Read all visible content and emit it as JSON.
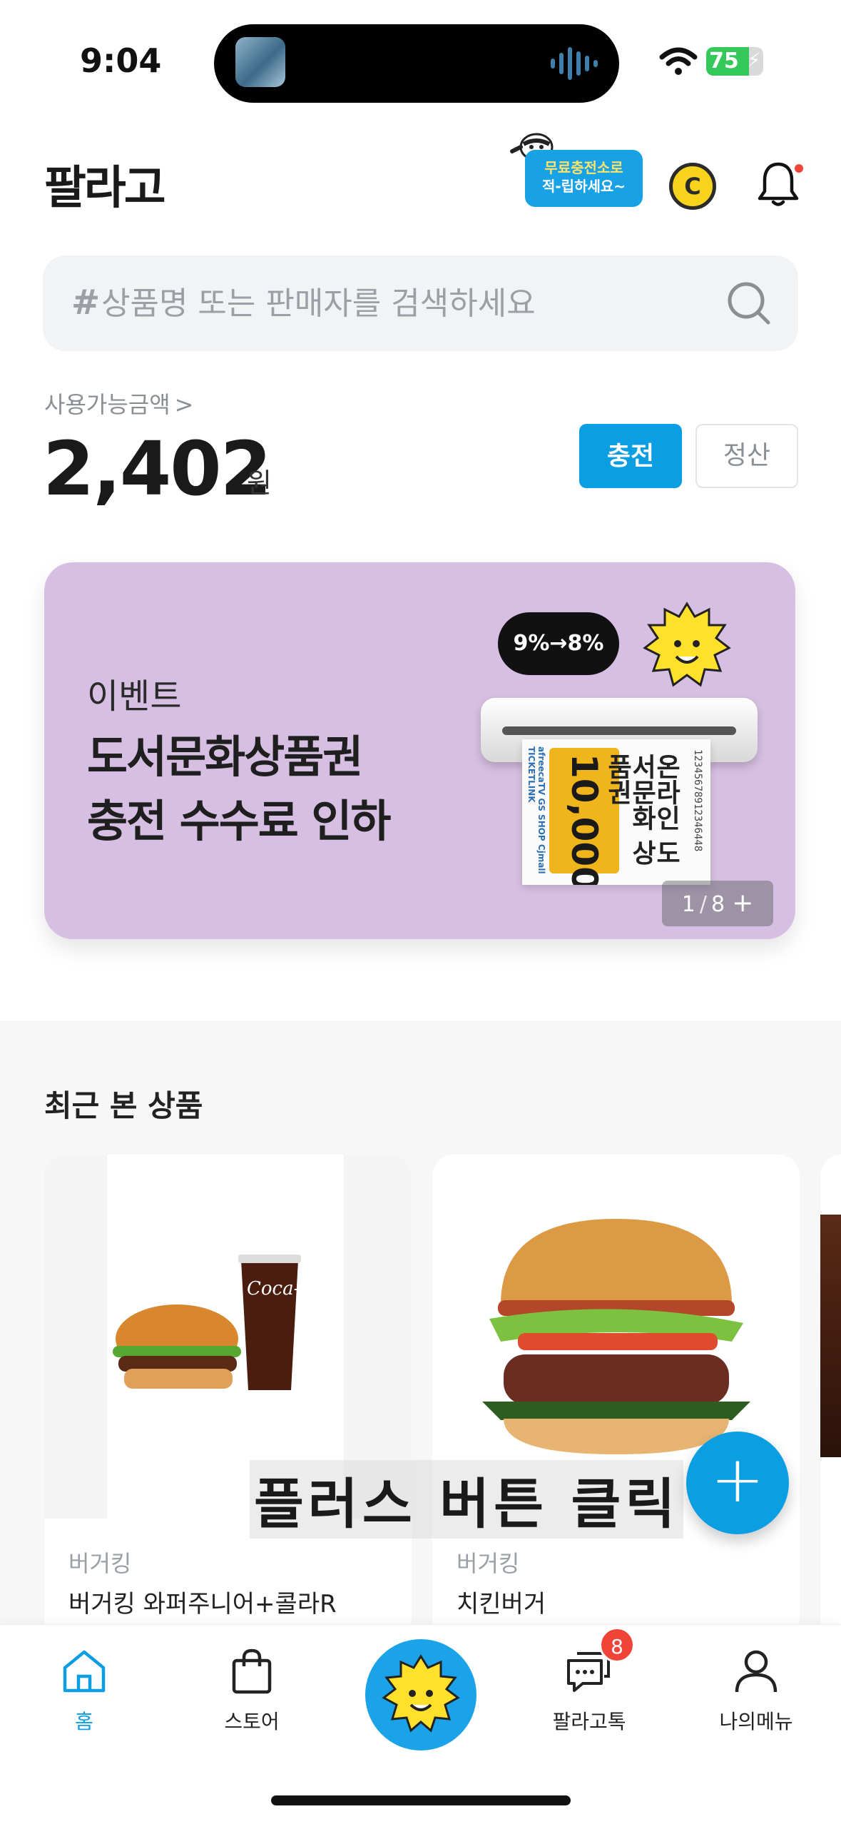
{
  "status_bar": {
    "time": "9:04",
    "battery": "75",
    "battery_level": 0.75
  },
  "header": {
    "logo": "팔라고",
    "promo_line1": "무료충전소로",
    "promo_line2": "적-립하세요~",
    "coin_symbol": "C"
  },
  "search": {
    "hash": "#",
    "placeholder": "상품명 또는 판매자를 검색하세요"
  },
  "balance": {
    "label": "사용가능금액",
    "chevron": ">",
    "amount": "2,402",
    "unit": "원",
    "charge_label": "충전",
    "settle_label": "정산"
  },
  "banner": {
    "tag": "이벤트",
    "title_line1": "도서문화상품권",
    "title_line2": "충전 수수료 인하",
    "speech": "9%→8%",
    "voucher_amount": "10,000",
    "voucher_title": "온라인 도서문화 상품권",
    "voucher_code": "12345678912346448",
    "voucher_brands": "afreecaTV GS SHOP Cjmall TICKETLINK",
    "pager_current": "1",
    "pager_sep": "/",
    "pager_total": "8",
    "pager_plus": "+"
  },
  "recent": {
    "title": "최근 본 상품",
    "items": [
      {
        "brand": "버거킹",
        "name": "버거킹 와퍼주니어+콜라R"
      },
      {
        "brand": "버거킹",
        "name": "치킨버거"
      }
    ]
  },
  "overlay": {
    "text": "플러스 버튼 클릭"
  },
  "fab": {
    "symbol": "+"
  },
  "nav": {
    "items": [
      {
        "label": "홈",
        "icon": "home-icon"
      },
      {
        "label": "스토어",
        "icon": "shopping-bag-icon"
      },
      {
        "label": "",
        "icon": "mascot-icon"
      },
      {
        "label": "팔라고톡",
        "icon": "chat-icon"
      },
      {
        "label": "나의메뉴",
        "icon": "person-icon"
      }
    ],
    "chat_badge": "8"
  },
  "colors": {
    "accent": "#0b9ee3",
    "banner_bg": "#d6bfe2",
    "badge": "#f04438"
  }
}
